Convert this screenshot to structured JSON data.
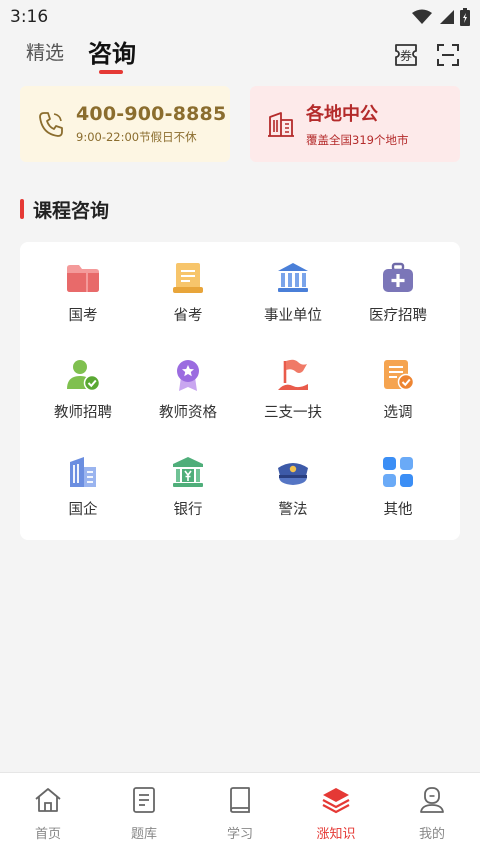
{
  "status_bar": {
    "time": "3:16"
  },
  "header": {
    "tabs": [
      {
        "label": "精选",
        "active": false
      },
      {
        "label": "咨询",
        "active": true
      }
    ],
    "coupon_icon_text": "券"
  },
  "phone_card": {
    "number": "400-900-8885",
    "hours": "9:00-22:00节假日不休"
  },
  "center_card": {
    "title": "各地中公",
    "subtitle": "覆盖全国319个地市"
  },
  "section": {
    "title": "课程咨询"
  },
  "grid": [
    {
      "label": "国考",
      "icon": "folder-icon"
    },
    {
      "label": "省考",
      "icon": "document-icon"
    },
    {
      "label": "事业单位",
      "icon": "institution-icon"
    },
    {
      "label": "医疗招聘",
      "icon": "medical-kit-icon"
    },
    {
      "label": "教师招聘",
      "icon": "teacher-check-icon"
    },
    {
      "label": "教师资格",
      "icon": "medal-icon"
    },
    {
      "label": "三支一扶",
      "icon": "flag-icon"
    },
    {
      "label": "选调",
      "icon": "checklist-icon"
    },
    {
      "label": "国企",
      "icon": "office-building-icon"
    },
    {
      "label": "银行",
      "icon": "bank-icon"
    },
    {
      "label": "警法",
      "icon": "police-cap-icon"
    },
    {
      "label": "其他",
      "icon": "grid-apps-icon"
    }
  ],
  "bottom_nav": [
    {
      "label": "首页",
      "icon": "home-icon",
      "active": false
    },
    {
      "label": "题库",
      "icon": "question-bank-icon",
      "active": false
    },
    {
      "label": "学习",
      "icon": "book-icon",
      "active": false
    },
    {
      "label": "涨知识",
      "icon": "layers-icon",
      "active": true
    },
    {
      "label": "我的",
      "icon": "profile-icon",
      "active": false
    }
  ],
  "colors": {
    "accent": "#e53935",
    "phone_card_bg": "#fdf6e3",
    "phone_text": "#8b6d2e",
    "center_card_bg": "#fdeaea",
    "center_text": "#b42b2b"
  }
}
